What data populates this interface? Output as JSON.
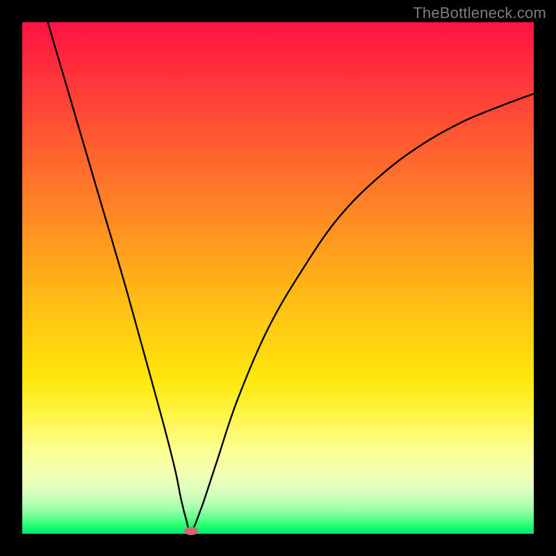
{
  "watermark": "TheBottleneck.com",
  "chart_data": {
    "type": "line",
    "title": "",
    "xlabel": "",
    "ylabel": "",
    "xlim": [
      0,
      100
    ],
    "ylim": [
      0,
      100
    ],
    "grid": false,
    "series": [
      {
        "name": "curve",
        "x": [
          5,
          10,
          15,
          20,
          25,
          28,
          30,
          31,
          32,
          33,
          35,
          38,
          42,
          48,
          55,
          62,
          70,
          78,
          86,
          94,
          100
        ],
        "values": [
          100,
          83,
          66,
          49,
          31,
          20,
          12,
          7,
          3,
          0.5,
          5,
          14,
          26,
          40,
          52,
          62,
          70,
          76,
          80.5,
          83.8,
          86
        ]
      }
    ],
    "marker": {
      "x": 33,
      "y": 0.5,
      "color": "#d16a6f"
    },
    "gradient_stops": [
      {
        "pos": 0,
        "color": "#ff1244"
      },
      {
        "pos": 50,
        "color": "#ffa91b"
      },
      {
        "pos": 80,
        "color": "#fff54a"
      },
      {
        "pos": 100,
        "color": "#00e676"
      }
    ]
  }
}
